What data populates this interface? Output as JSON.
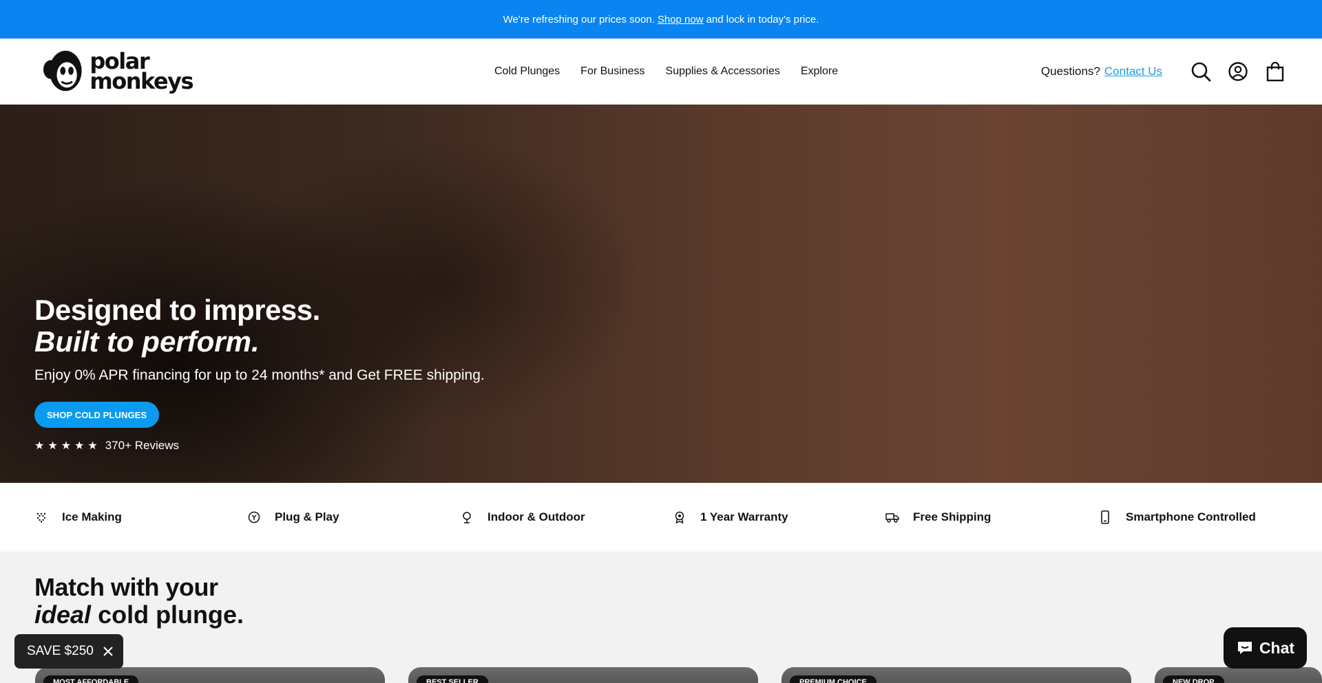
{
  "announcement": {
    "before": "We're refreshing our prices soon.",
    "link": "Shop now",
    "after": "and lock in today's price."
  },
  "logo": {
    "line1": "polar",
    "line2": "monkeys"
  },
  "nav": [
    {
      "label": "Cold Plunges"
    },
    {
      "label": "For Business"
    },
    {
      "label": "Supplies & Accessories"
    },
    {
      "label": "Explore"
    }
  ],
  "header": {
    "questions": "Questions?",
    "contact": "Contact Us",
    "icons": [
      "search-icon",
      "account-icon",
      "cart-icon"
    ]
  },
  "hero": {
    "title_line1": "Designed to impress.",
    "title_line2": "Built to perform.",
    "subtitle": "Enjoy 0% APR financing for up to 24 months* and Get FREE shipping.",
    "button": "SHOP COLD PLUNGES",
    "stars": "★★★★★",
    "rating": 5,
    "reviews": "370+ Reviews"
  },
  "features": [
    {
      "label": "Ice Making",
      "icon": "snowflake-icon"
    },
    {
      "label": "Plug & Play",
      "icon": "plug-icon"
    },
    {
      "label": "Indoor & Outdoor",
      "icon": "tree-icon"
    },
    {
      "label": "1 Year Warranty",
      "icon": "award-icon"
    },
    {
      "label": "Free Shipping",
      "icon": "truck-icon"
    },
    {
      "label": "Smartphone Controlled",
      "icon": "smartphone-icon"
    }
  ],
  "match": {
    "line1": "Match with your",
    "ideal": "ideal",
    "rest": "cold plunge."
  },
  "cards": [
    {
      "badge": "MOST AFFORDABLE"
    },
    {
      "badge": "BEST SELLER"
    },
    {
      "badge": "PREMIUM CHOICE"
    },
    {
      "badge": "NEW DROP"
    }
  ],
  "promo": {
    "label": "SAVE $250"
  },
  "chat": {
    "label": "Chat"
  },
  "colors": {
    "accent": "#0a84f0",
    "button": "#0a9bf0",
    "link": "#1a9ce0",
    "dark": "#111111"
  }
}
